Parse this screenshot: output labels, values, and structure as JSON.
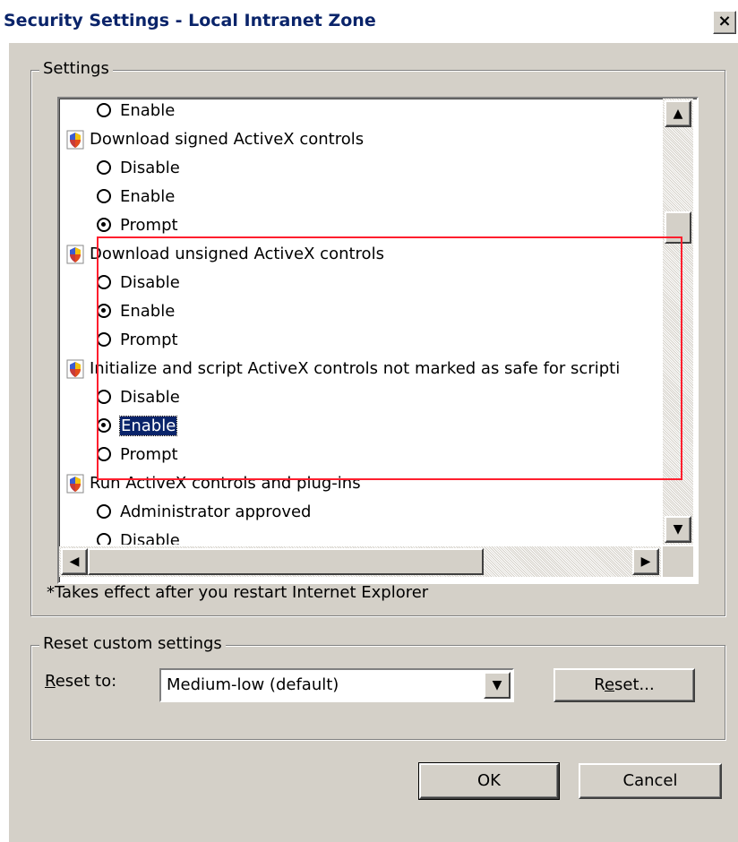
{
  "window": {
    "title": "Security Settings - Local Intranet Zone",
    "close_glyph": "×"
  },
  "settings_group": {
    "legend": "Settings",
    "rows": [
      {
        "type": "option",
        "label": "Enable",
        "checked": false
      },
      {
        "type": "category",
        "label": "Download signed ActiveX controls",
        "icon": "shield-icon"
      },
      {
        "type": "option",
        "label": "Disable",
        "checked": false
      },
      {
        "type": "option",
        "label": "Enable",
        "checked": false
      },
      {
        "type": "option",
        "label": "Prompt",
        "checked": true
      },
      {
        "type": "category",
        "label": "Download unsigned ActiveX controls",
        "icon": "shield-icon"
      },
      {
        "type": "option",
        "label": "Disable",
        "checked": false
      },
      {
        "type": "option",
        "label": "Enable",
        "checked": true
      },
      {
        "type": "option",
        "label": "Prompt",
        "checked": false
      },
      {
        "type": "category",
        "label": "Initialize and script ActiveX controls not marked as safe for scripti",
        "icon": "shield-icon"
      },
      {
        "type": "option",
        "label": "Disable",
        "checked": false
      },
      {
        "type": "option",
        "label": "Enable",
        "checked": true,
        "selected": true
      },
      {
        "type": "option",
        "label": "Prompt",
        "checked": false
      },
      {
        "type": "category",
        "label": "Run ActiveX controls and plug-ins",
        "icon": "shield-icon"
      },
      {
        "type": "option",
        "label": "Administrator approved",
        "checked": false
      },
      {
        "type": "option",
        "label": "Disable",
        "checked": false
      }
    ],
    "note": "*Takes effect after you restart Internet Explorer"
  },
  "reset_group": {
    "legend": "Reset custom settings",
    "reset_to_label_prefix": "",
    "reset_to_label_u": "R",
    "reset_to_label_rest": "eset to:",
    "reset_to_value": "Medium-low (default)",
    "reset_btn_pre": "R",
    "reset_btn_u": "e",
    "reset_btn_rest": "set..."
  },
  "buttons": {
    "ok": "OK",
    "cancel": "Cancel"
  },
  "colors": {
    "highlight": "#0a246a",
    "annotation_box": "#ff1f2e",
    "dialog_bg": "#d4d0c8"
  }
}
